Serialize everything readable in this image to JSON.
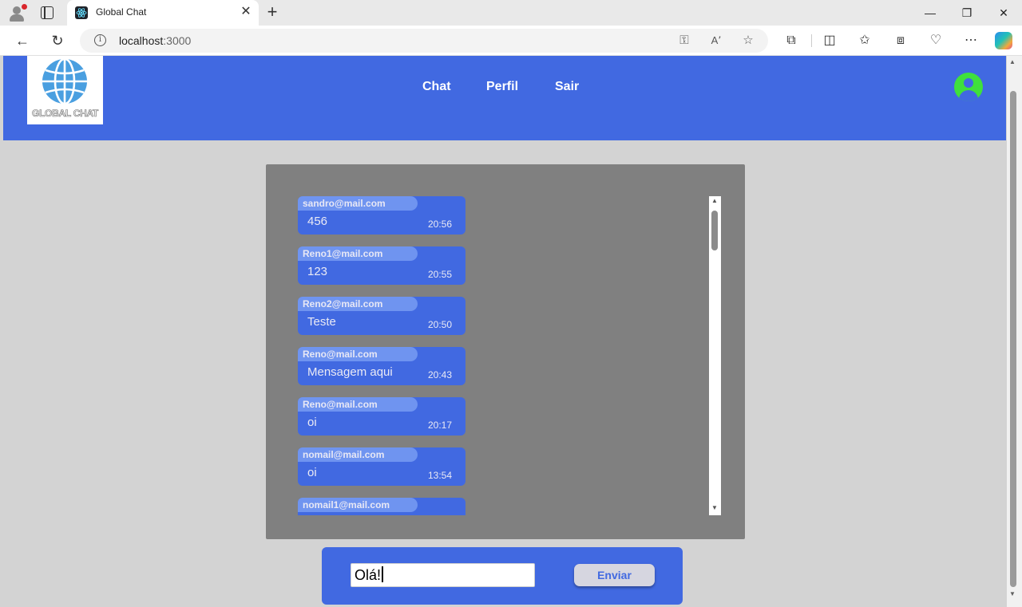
{
  "browser": {
    "tab_title": "Global Chat",
    "url_host": "localhost",
    "url_port": ":3000"
  },
  "app": {
    "logo_text": "GLOBAL CHAT",
    "nav": [
      {
        "label": "Chat"
      },
      {
        "label": "Perfil"
      },
      {
        "label": "Sair"
      }
    ],
    "accent_color": "#4169e1",
    "avatar_color": "#3fe03c"
  },
  "messages": [
    {
      "sender": "sandro@mail.com",
      "text": "456",
      "time": "20:56"
    },
    {
      "sender": "Reno1@mail.com",
      "text": "123",
      "time": "20:55"
    },
    {
      "sender": "Reno2@mail.com",
      "text": "Teste",
      "time": "20:50"
    },
    {
      "sender": "Reno@mail.com",
      "text": "Mensagem aqui",
      "time": "20:43"
    },
    {
      "sender": "Reno@mail.com",
      "text": "oi",
      "time": "20:17"
    },
    {
      "sender": "nomail@mail.com",
      "text": "oi",
      "time": "13:54"
    },
    {
      "sender": "nomail1@mail.com",
      "text": "",
      "time": ""
    }
  ],
  "composer": {
    "value": "Olá!",
    "send_label": "Enviar"
  }
}
